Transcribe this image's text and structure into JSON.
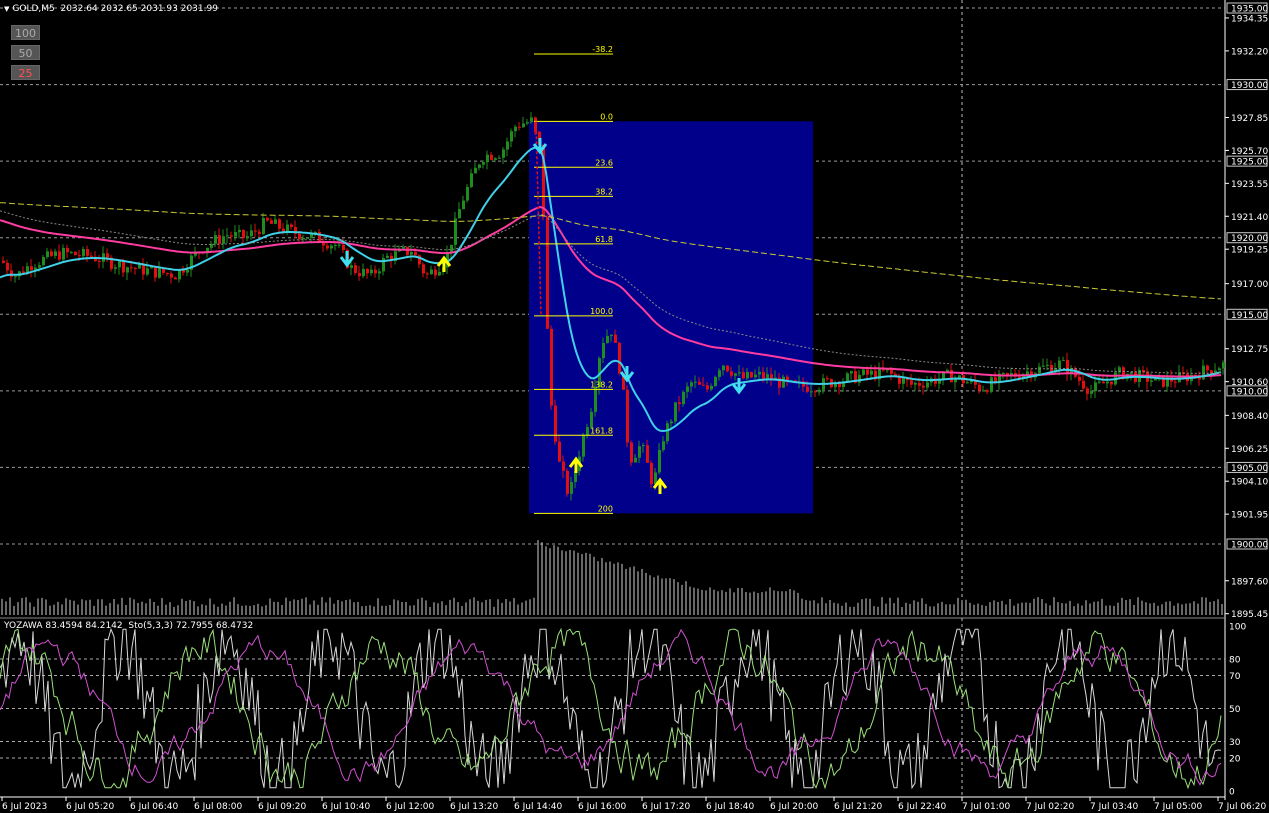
{
  "header": {
    "symbol": "GOLD,M5",
    "ohlc": "2032.64 2032.65 2031.93 2031.99"
  },
  "zoom_buttons": [
    "100",
    "50",
    "25"
  ],
  "price_axis": {
    "labels": [
      "1934.35",
      "1932.20",
      "1927.85",
      "1925.70",
      "1923.55",
      "1921.40",
      "1919.25",
      "1917.00",
      "1912.75",
      "1910.60",
      "1908.40",
      "1906.25",
      "1904.10",
      "1901.95",
      "1897.60",
      "1895.45"
    ],
    "boxed_labels": [
      "1935.00",
      "1930.00",
      "1925.00",
      "1920.00",
      "1915.00",
      "1910.00",
      "1905.00",
      "1900.00"
    ]
  },
  "time_axis": {
    "labels": [
      "6 Jul 2023",
      "6 Jul 05:20",
      "6 Jul 06:40",
      "6 Jul 08:00",
      "6 Jul 09:20",
      "6 Jul 10:40",
      "6 Jul 12:00",
      "6 Jul 13:20",
      "6 Jul 14:40",
      "6 Jul 16:00",
      "6 Jul 17:20",
      "6 Jul 18:40",
      "6 Jul 20:00",
      "6 Jul 21:20",
      "6 Jul 22:40",
      "7 Jul 01:00",
      "7 Jul 02:20",
      "7 Jul 03:40",
      "7 Jul 05:00",
      "7 Jul 06:20"
    ]
  },
  "fibonacci": {
    "levels": [
      "-38.2",
      "0.0",
      "23.6",
      "38.2",
      "61.8",
      "100.0",
      "138.2",
      "161.8",
      "200"
    ]
  },
  "indicator": {
    "title": "YOZAWA 83.4594 84.2142",
    "stoch": "Sto(5,3,3) 72.7955 68.4732",
    "axis_labels": [
      "100",
      "80",
      "70",
      "50",
      "30",
      "20",
      "0"
    ]
  },
  "colors": {
    "background": "#000000",
    "bull": "#1f8c1f",
    "bear": "#e01010",
    "fib_box": "#00008b",
    "fib_line": "#ffff00",
    "ma_fast": "#40d0e8",
    "ma_slow": "#ff3ca0",
    "arrow_up": "#ffff00",
    "arrow_down": "#40e0f0"
  },
  "chart_data": {
    "type": "candlestick",
    "symbol": "GOLD",
    "timeframe": "M5",
    "ylim": [
      1894.5,
      1935.5
    ],
    "price_path": [
      [
        0,
        1918.5
      ],
      [
        15,
        1917.5
      ],
      [
        30,
        1918.3
      ],
      [
        60,
        1919.0
      ],
      [
        90,
        1918.8
      ],
      [
        120,
        1918.2
      ],
      [
        150,
        1917.8
      ],
      [
        175,
        1917.6
      ],
      [
        200,
        1919.3
      ],
      [
        225,
        1920.2
      ],
      [
        245,
        1920.0
      ],
      [
        265,
        1921.0
      ],
      [
        290,
        1920.4
      ],
      [
        315,
        1920.0
      ],
      [
        335,
        1919.5
      ],
      [
        350,
        1918.0
      ],
      [
        370,
        1917.5
      ],
      [
        385,
        1918.7
      ],
      [
        410,
        1919.2
      ],
      [
        425,
        1917.5
      ],
      [
        445,
        1918.6
      ],
      [
        460,
        1922.3
      ],
      [
        480,
        1925.3
      ],
      [
        500,
        1925.6
      ],
      [
        515,
        1927.4
      ],
      [
        530,
        1927.6
      ],
      [
        540,
        1925.4
      ],
      [
        548,
        1910.0
      ],
      [
        558,
        1905.2
      ],
      [
        568,
        1903.1
      ],
      [
        578,
        1906.0
      ],
      [
        590,
        1909.0
      ],
      [
        600,
        1913.2
      ],
      [
        610,
        1914.0
      ],
      [
        620,
        1911.0
      ],
      [
        628,
        1905.5
      ],
      [
        640,
        1906.5
      ],
      [
        652,
        1903.8
      ],
      [
        662,
        1907.0
      ],
      [
        675,
        1909.0
      ],
      [
        690,
        1910.5
      ],
      [
        705,
        1910.0
      ],
      [
        720,
        1911.9
      ],
      [
        740,
        1910.8
      ],
      [
        760,
        1911.0
      ],
      [
        790,
        1910.3
      ],
      [
        810,
        1910.3
      ],
      [
        860,
        1911.0
      ],
      [
        885,
        1911.2
      ],
      [
        910,
        1910.4
      ],
      [
        950,
        1911.0
      ],
      [
        980,
        1910.2
      ],
      [
        1010,
        1911.0
      ],
      [
        1060,
        1911.8
      ],
      [
        1090,
        1910.0
      ],
      [
        1120,
        1911.2
      ],
      [
        1160,
        1910.6
      ],
      [
        1190,
        1911.0
      ],
      [
        1220,
        1911.7
      ]
    ]
  }
}
